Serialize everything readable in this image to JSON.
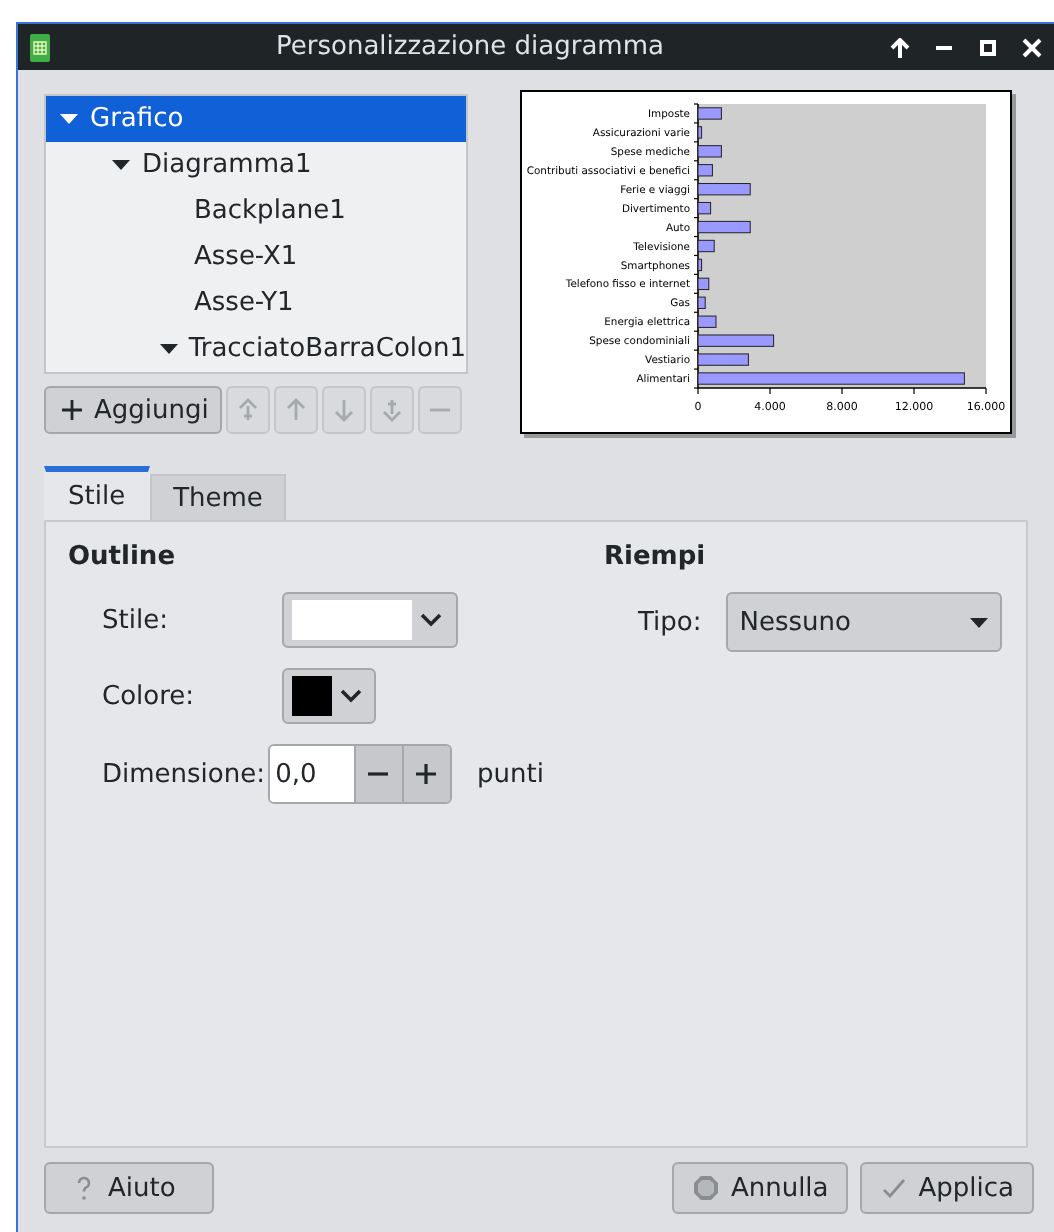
{
  "window": {
    "title": "Personalizzazione diagramma"
  },
  "tree": [
    {
      "label": "Grafico",
      "selected": true,
      "expanded": true,
      "children": [
        {
          "label": "Diagramma1",
          "selected": false,
          "expanded": true,
          "children": [
            {
              "label": "Backplane1",
              "selected": false
            },
            {
              "label": "Asse-X1",
              "selected": false
            },
            {
              "label": "Asse-Y1",
              "selected": false
            },
            {
              "label": "TracciatoBarraColon1",
              "selected": false,
              "expanded": true
            }
          ]
        }
      ]
    }
  ],
  "toolbar": [
    {
      "kind": "add",
      "label": "Aggiungi",
      "disabled": false
    },
    {
      "kind": "top",
      "disabled": true
    },
    {
      "kind": "up",
      "disabled": true
    },
    {
      "kind": "down",
      "disabled": true
    },
    {
      "kind": "bottom",
      "disabled": true
    },
    {
      "kind": "remove",
      "disabled": true
    }
  ],
  "preview": {
    "chart_data": {
      "type": "bar",
      "orientation": "horizontal",
      "categories": [
        "Imposte",
        "Assicurazioni varie",
        "Spese mediche",
        "Contributi associativi e benefici",
        "Ferie e viaggi",
        "Divertimento",
        "Auto",
        "Televisione",
        "Smartphones",
        "Telefono fisso e internet",
        "Gas",
        "Energia elettrica",
        "Spese condominiali",
        "Vestiario",
        "Alimentari"
      ],
      "series": [
        {
          "color": "#9999ff",
          "values": [
            1300,
            200,
            1300,
            800,
            2900,
            700,
            2900,
            900,
            200,
            600,
            400,
            1000,
            4200,
            2800,
            14800
          ]
        }
      ],
      "xlim": [
        0,
        16000
      ],
      "xticks": [
        {
          "value": 0,
          "label": "0"
        },
        {
          "value": 4000,
          "label": "4.000"
        },
        {
          "value": 8000,
          "label": "8.000"
        },
        {
          "value": 12000,
          "label": "12.000"
        },
        {
          "value": 16000,
          "label": "16.000"
        }
      ]
    }
  },
  "tabs": [
    {
      "label": "Stile",
      "selected": true
    },
    {
      "label": "Theme",
      "selected": false
    }
  ],
  "outline": {
    "heading": "Outline",
    "style_label": "Stile:",
    "color_label": "Colore:",
    "color": "#000000",
    "size_label": "Dimensione:",
    "size_value": "0,0",
    "size_unit": "punti"
  },
  "fill": {
    "heading": "Riempi",
    "type_label": "Tipo:",
    "type_value": "Nessuno"
  },
  "buttons": [
    {
      "kind": "help",
      "label": "Aiuto"
    },
    {
      "kind": "cancel",
      "label": "Annulla"
    },
    {
      "kind": "apply",
      "label": "Applica"
    }
  ]
}
